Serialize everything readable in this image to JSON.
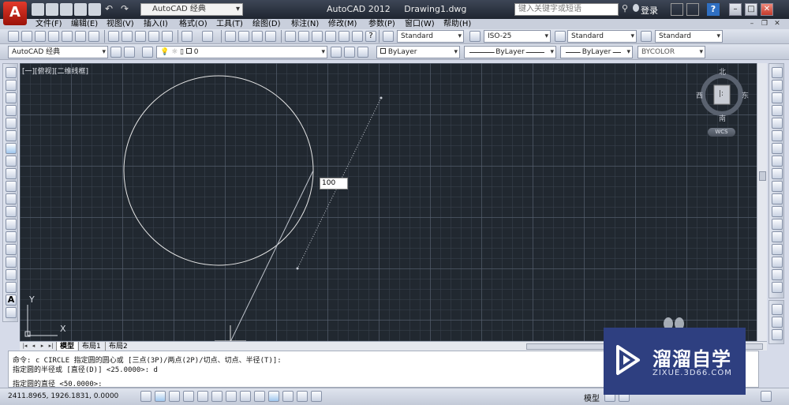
{
  "window": {
    "app_title": "AutoCAD 2012",
    "document_title": "Drawing1.dwg",
    "workspace": "AutoCAD 经典",
    "search_placeholder": "键入关键字或短语",
    "login_label": "登录",
    "help_label": "?"
  },
  "menu": {
    "items": [
      "文件(F)",
      "编辑(E)",
      "视图(V)",
      "插入(I)",
      "格式(O)",
      "工具(T)",
      "绘图(D)",
      "标注(N)",
      "修改(M)",
      "参数(P)",
      "窗口(W)",
      "帮助(H)"
    ]
  },
  "styles_toolbar": {
    "text_style": "Standard",
    "dim_style": "ISO-25",
    "table_style": "Standard",
    "multileader_style": "Standard"
  },
  "layers_toolbar": {
    "workspace": "AutoCAD 经典",
    "current_layer": "0",
    "color": "ByLayer",
    "linetype": "ByLayer",
    "lineweight": "ByLayer",
    "plot_style": "BYCOLOR"
  },
  "viewport": {
    "label": "[一][俯视][二维线框]",
    "dynamic_input_value": "100",
    "ucs_x": "X",
    "ucs_y": "Y"
  },
  "viewcube": {
    "north": "北",
    "south": "南",
    "east": "东",
    "west": "西",
    "wcs_label": "WCS"
  },
  "layout_tabs": [
    "模型",
    "布局1",
    "布局2"
  ],
  "command_line": {
    "history": [
      "命令: c CIRCLE 指定圆的圆心或 [三点(3P)/两点(2P)/切点、切点、半径(T)]:",
      "指定圆的半径或 [直径(D)] <25.0000>: d"
    ],
    "current_prompt": "指定圆的直径 <50.0000>:"
  },
  "status_bar": {
    "coordinates": "2411.8965, 1926.1831, 0.0000",
    "model_label": "模型"
  },
  "watermark": {
    "title": "溜溜自学",
    "url": "ZIXUE.3D66.COM"
  },
  "colors": {
    "canvas_bg": "#212830",
    "circle": "#e6e6e6",
    "titlebar": "#2b323e",
    "watermark_bg": "#2e3f80"
  }
}
